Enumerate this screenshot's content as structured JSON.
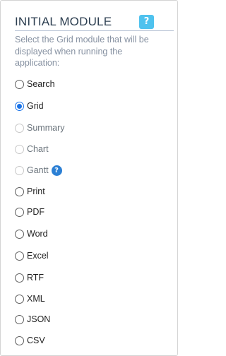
{
  "section": {
    "title": "INITIAL MODULE",
    "help_icon": "?",
    "description": "Select the Grid module that will be displayed when running the application:"
  },
  "options": [
    {
      "label": "Search",
      "checked": false,
      "disabled": false
    },
    {
      "label": "Grid",
      "checked": true,
      "disabled": false
    },
    {
      "label": "Summary",
      "checked": false,
      "disabled": true
    },
    {
      "label": "Chart",
      "checked": false,
      "disabled": true
    },
    {
      "label": "Gantt",
      "checked": false,
      "disabled": true,
      "help_icon": "?"
    },
    {
      "label": "Print",
      "checked": false,
      "disabled": false
    },
    {
      "label": "PDF",
      "checked": false,
      "disabled": false
    },
    {
      "label": "Word",
      "checked": false,
      "disabled": false
    },
    {
      "label": "Excel",
      "checked": false,
      "disabled": false
    },
    {
      "label": "RTF",
      "checked": false,
      "disabled": false
    },
    {
      "label": "XML",
      "checked": false,
      "disabled": false
    },
    {
      "label": "JSON",
      "checked": false,
      "disabled": false
    },
    {
      "label": "CSV",
      "checked": false,
      "disabled": false
    }
  ],
  "colors": {
    "accent": "#1a73e8",
    "help_main": "#4fc2ee",
    "help_small": "#2b7fd4",
    "title": "#2c3e50",
    "description": "#8792a2"
  }
}
